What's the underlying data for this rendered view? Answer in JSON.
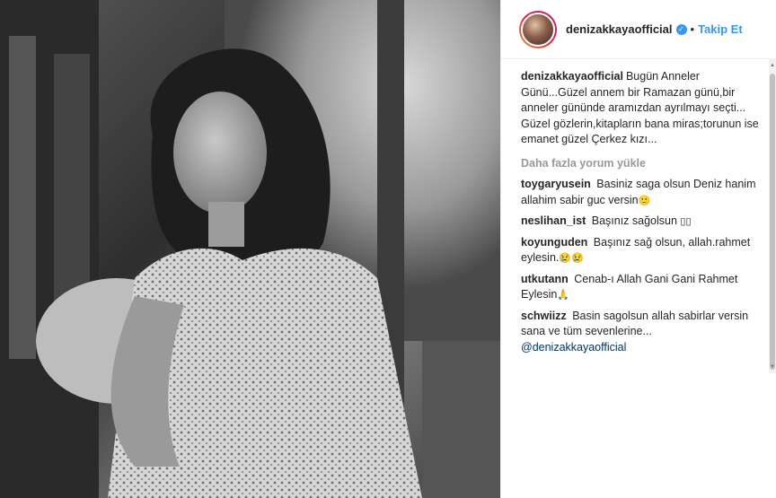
{
  "post": {
    "username": "denizakkaya​official",
    "verified_glyph": "✓",
    "separator": "•",
    "follow_label": "Takip Et"
  },
  "caption": {
    "username": "denizakkayaofficial",
    "text": "Bugün Anneler\nGünü...Güzel annem bir Ramazan günü,bir anneler gününde aramızdan ayrılmayı seçti...\nGüzel gözlerin,kitapların bana miras;torunun ise emanet güzel Çerkez kızı..."
  },
  "load_more_label": "Daha fazla yorum yükle",
  "comments": [
    {
      "username": "toygaryusein",
      "text": "Basiniz saga olsun Deniz hanim allahim sabir guc versin",
      "emoji": "🙂"
    },
    {
      "username": "neslihan_ist",
      "text": "Başınız sağolsun",
      "emoji": "▯▯"
    },
    {
      "username": "koyunguden",
      "text": "Başınız sağ olsun, allah.rahmet eylesin.",
      "emoji": "😢😢"
    },
    {
      "username": "utkutann",
      "text": "Cenab-ı Allah Gani Gani Rahmet Eylesin",
      "emoji": "🙏"
    },
    {
      "username": "schwiizz",
      "text": "Basin sagolsun allah sabirlar versin sana ve tüm sevenlerine...",
      "mention": "@denizakkayaofficial"
    }
  ],
  "icons": {
    "verified": "verified-badge-icon",
    "avatar": "profile-avatar"
  },
  "colors": {
    "link_blue": "#3897f0",
    "text": "#262626",
    "muted": "#999999",
    "mention": "#003569"
  }
}
